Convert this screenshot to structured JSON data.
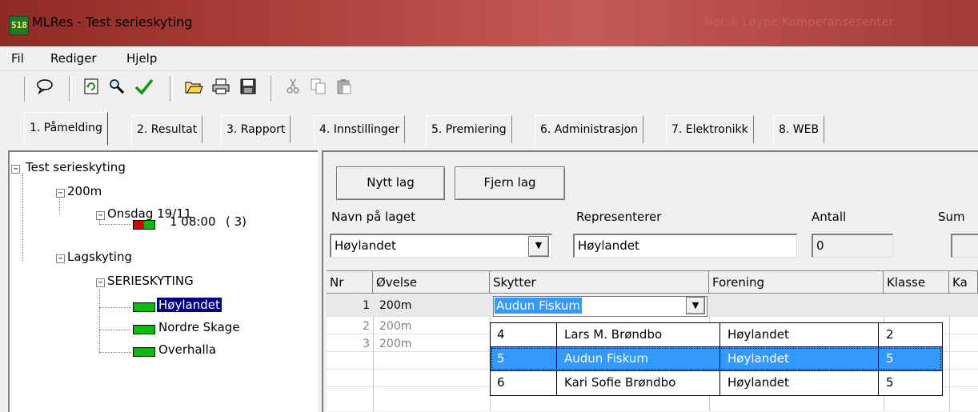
{
  "window": {
    "title": "MLRes - Test serieskyting",
    "icon_text": "518",
    "title_watermark": "Norsk Løype Kompetansesenter"
  },
  "menu": [
    "Fil",
    "Rediger",
    "Hjelp"
  ],
  "toolbar": {
    "buttons": [
      "speech-bubble-icon",
      "refresh-icon",
      "magnifier-icon",
      "checkmark-icon",
      "open-folder-icon",
      "printer-icon",
      "save-icon",
      "cut-icon",
      "copy-icon",
      "paste-icon"
    ]
  },
  "tabs": [
    "1. Påmelding",
    "2. Resultat",
    "3. Rapport",
    "4. Innstillinger",
    "5. Premiering",
    "6. Administrasjon",
    "7. Elektronikk",
    "8. WEB"
  ],
  "tree": {
    "root": "Test serieskyting",
    "distance": "200m",
    "day": "Onsdag 19/11",
    "relay_time": "1 08:00",
    "relay_count": "( 3)",
    "team_shooting": "Lagskyting",
    "series": "SERIESKYTING",
    "teams": [
      "Høylandet",
      "Nordre Skage",
      "Overhalla"
    ],
    "selected_team": "Høylandet"
  },
  "buttons": {
    "new_team": "Nytt lag",
    "remove_team": "Fjern lag"
  },
  "form": {
    "team_name_label": "Navn på laget",
    "team_name_value": "Høylandet",
    "represents_label": "Representerer",
    "represents_value": "Høylandet",
    "count_label": "Antall",
    "count_value": "0",
    "sum_label": "Sum"
  },
  "grid": {
    "headers": [
      "Nr",
      "Øvelse",
      "Skytter",
      "Forening",
      "Klasse",
      "Ka"
    ],
    "rows": [
      {
        "nr": "1",
        "ovelse": "200m",
        "skytter": "Audun Fiskum"
      },
      {
        "nr": "2",
        "ovelse": "200m",
        "skytter": ""
      },
      {
        "nr": "3",
        "ovelse": "200m",
        "skytter": ""
      }
    ]
  },
  "popup": {
    "rows": [
      {
        "id": "4",
        "name": "Lars M. Brøndbo",
        "club": "Høylandet",
        "class": "2"
      },
      {
        "id": "5",
        "name": "Audun Fiskum",
        "club": "Høylandet",
        "class": "5"
      },
      {
        "id": "6",
        "name": "Kari Sofie Brøndbo",
        "club": "Høylandet",
        "class": "5"
      }
    ],
    "selected_index": 1
  }
}
